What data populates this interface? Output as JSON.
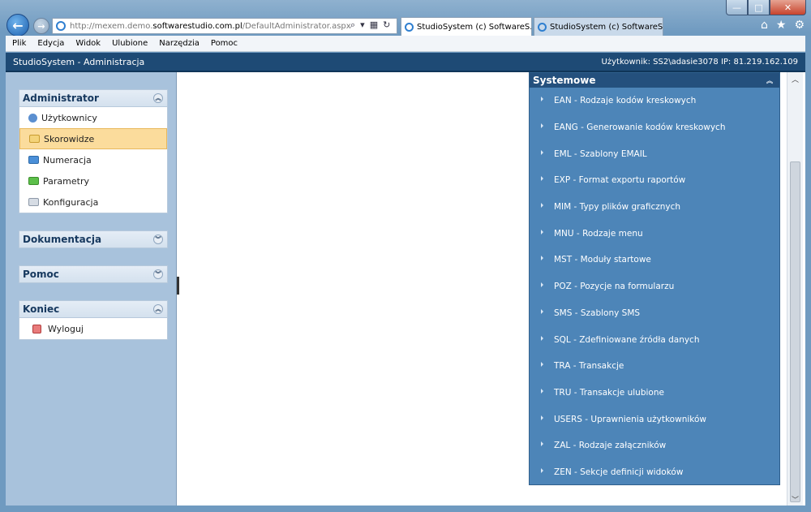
{
  "browser": {
    "address_prefix": "http://mexem.demo.",
    "address_domain": "softwarestudio.com.pl",
    "address_suffix": "/DefaultAdministrator.aspx",
    "tabs": [
      {
        "label": "StudioSystem (c) SoftwareS...",
        "active": true
      },
      {
        "label": "StudioSystem (c) SoftwareStud...",
        "active": false
      }
    ],
    "tab_close": "×"
  },
  "menubar": [
    "Plik",
    "Edycja",
    "Widok",
    "Ulubione",
    "Narzędzia",
    "Pomoc"
  ],
  "app": {
    "title": "StudioSystem - Administracja",
    "user_info": "Użytkownik: SS2\\adasie3078 IP: 81.219.162.109"
  },
  "sidebar": {
    "panels": [
      {
        "title": "Administrator",
        "items": [
          "Użytkownicy",
          "Skorowidze",
          "Numeracja",
          "Parametry",
          "Konfiguracja"
        ],
        "selected": "Skorowidze"
      },
      {
        "title": "Dokumentacja"
      },
      {
        "title": "Pomoc"
      },
      {
        "title": "Koniec",
        "items": [
          "Wyloguj"
        ]
      }
    ]
  },
  "systemowe": {
    "title": "Systemowe",
    "items": [
      "EAN - Rodzaje kodów kreskowych",
      "EANG - Generowanie kodów kreskowych",
      "EML - Szablony EMAIL",
      "EXP - Format exportu raportów",
      "MIM - Typy plików graficznych",
      "MNU - Rodzaje menu",
      "MST - Moduły startowe",
      "POZ - Pozycje na formularzu",
      "SMS - Szablony SMS",
      "SQL - Zdefiniowane źródła danych",
      "TRA - Transakcje",
      "TRU - Transakcje ulubione",
      "USERS - Uprawnienia użytkowników",
      "ZAL - Rodzaje załączników",
      "ZEN - Sekcje definicji widoków"
    ]
  },
  "colors": {
    "header": "#1e4a75",
    "sidebar": "#a8c2dc",
    "systemowe": "#4d85b8",
    "selected": "#fbdc9c"
  }
}
